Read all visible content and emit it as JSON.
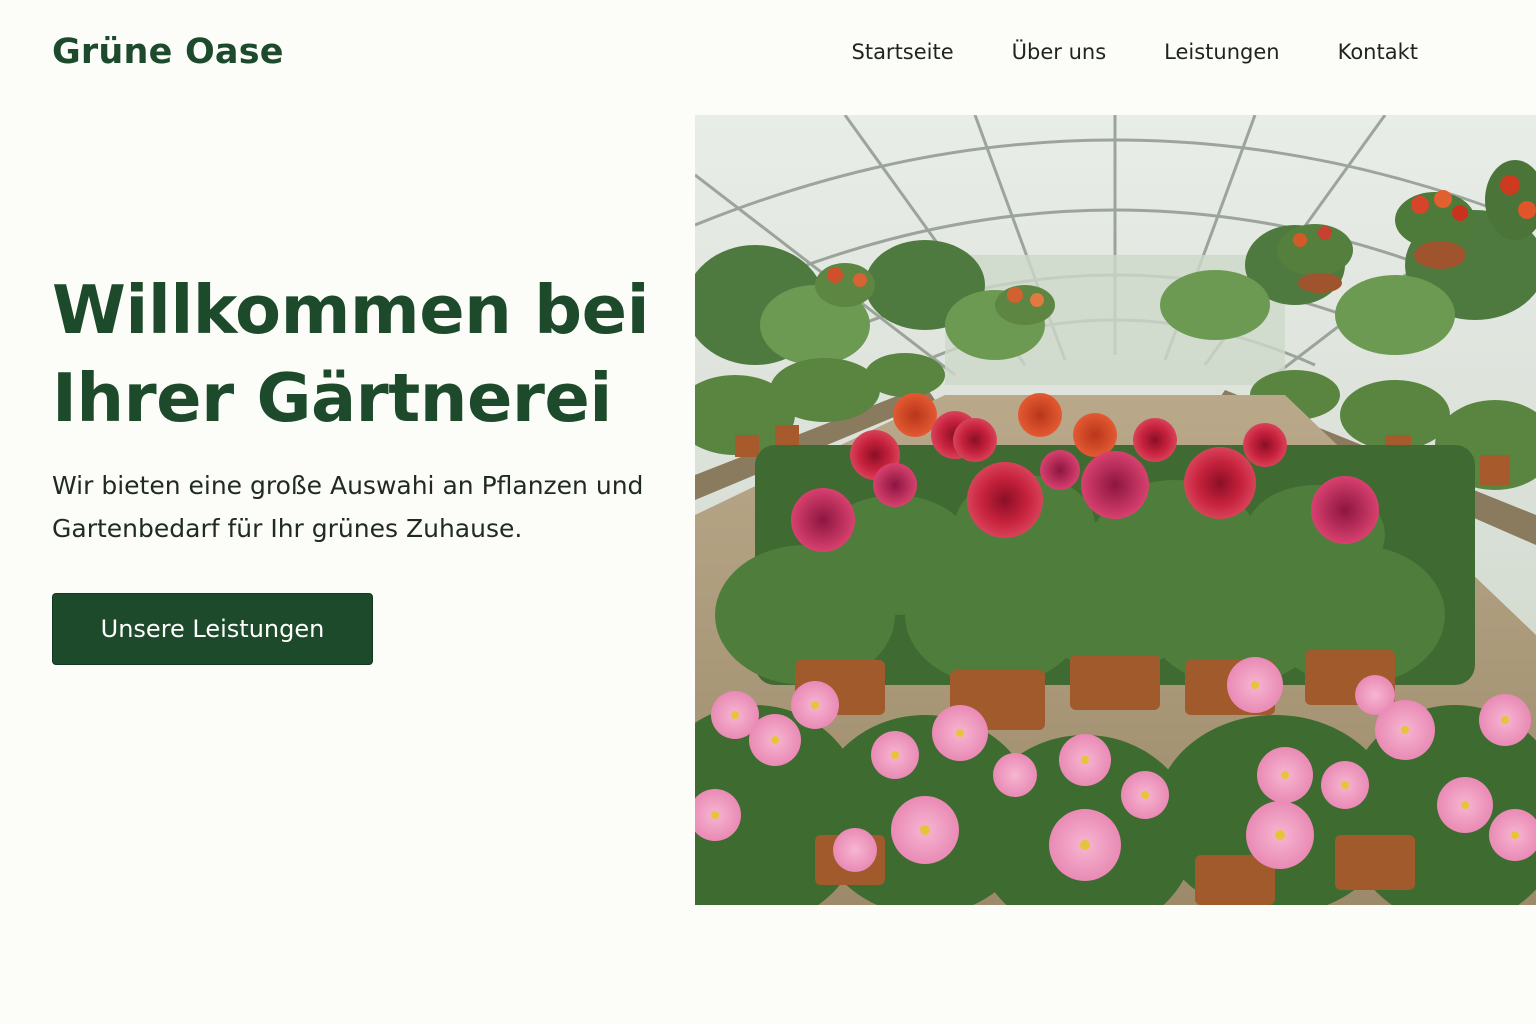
{
  "brand": {
    "name": "Grüne Oase"
  },
  "nav": {
    "items": [
      {
        "label": "Startseite"
      },
      {
        "label": "Über uns"
      },
      {
        "label": "Leistungen"
      },
      {
        "label": "Kontakt"
      }
    ]
  },
  "hero": {
    "title_line1": "Willkommen bei",
    "title_line2": "Ihrer Gärtnerei",
    "subtitle_line1": "Wir bieten eine große Auswahi an Pflanzen und",
    "subtitle_line2": "Gartenbedarf für Ihr grünes Zuhause.",
    "cta_label": "Unsere Leistungen",
    "image_alt": "Gewächshaus mit Dahlien und Petunien"
  },
  "colors": {
    "brand_green": "#1c4a2a",
    "background": "#fcfcf9",
    "text": "#1f2a23"
  }
}
